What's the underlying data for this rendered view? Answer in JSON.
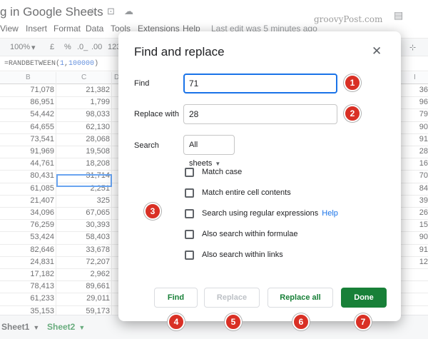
{
  "app": {
    "doc_title": "g in Google Sheets",
    "watermark": "groovyPost.com"
  },
  "menu": [
    "View",
    "Insert",
    "Format",
    "Data",
    "Tools",
    "Extensions",
    "Help"
  ],
  "last_edit": "Last edit was 5 minutes ago",
  "toolbar": {
    "zoom": "100%",
    "currency": "£",
    "percent": "%",
    "dec_decrease": ".0_",
    "dec_increase": ".00",
    "more_formats": "123"
  },
  "formula_bar": {
    "prefix": "=RANDBETWEEN(",
    "arg1": "1",
    "sep": ",",
    "arg2": "100000",
    "suffix": ")"
  },
  "grid": {
    "col_headers": [
      "B",
      "C",
      "D",
      "I"
    ],
    "col_b": [
      "71,078",
      "86,951",
      "54,442",
      "64,655",
      "73,541",
      "91,969",
      "44,761",
      "80,431",
      "61,085",
      "21,407",
      "34,096",
      "76,259",
      "53,424",
      "82,646",
      "24,831",
      "17,182",
      "78,413",
      "61,233",
      "35,153"
    ],
    "col_c": [
      "21,382",
      "1,799",
      "98,033",
      "62,130",
      "28,068",
      "19,508",
      "18,208",
      "31,714",
      "2,251",
      "325",
      "67,065",
      "30,393",
      "58,403",
      "33,678",
      "72,207",
      "2,962",
      "89,661",
      "29,011",
      "59,173"
    ],
    "col_i": [
      "36",
      "96",
      "79",
      "90",
      "91",
      "28",
      "16",
      "70",
      "84",
      "39",
      "26",
      "15",
      "90",
      "91",
      "12",
      "",
      "",
      "",
      ""
    ]
  },
  "sheets": [
    {
      "label": "Sheet1",
      "active": false
    },
    {
      "label": "Sheet2",
      "active": true
    }
  ],
  "dialog": {
    "title": "Find and replace",
    "close_icon": "close-icon",
    "find_label": "Find",
    "find_value": "71",
    "replace_label": "Replace with",
    "replace_value": "28",
    "search_label": "Search",
    "search_value": "All sheets",
    "options": [
      {
        "label": "Match case",
        "checked": false
      },
      {
        "label": "Match entire cell contents",
        "checked": false
      },
      {
        "label": "Search using regular expressions",
        "checked": false,
        "help": "Help"
      },
      {
        "label": "Also search within formulae",
        "checked": false
      },
      {
        "label": "Also search within links",
        "checked": false
      }
    ],
    "buttons": {
      "find": "Find",
      "replace": "Replace",
      "replace_all": "Replace all",
      "done": "Done"
    }
  },
  "callouts": [
    "1",
    "2",
    "3",
    "4",
    "5",
    "6",
    "7"
  ],
  "colors": {
    "accent_green": "#188038",
    "focus_blue": "#1a73e8",
    "callout_red": "#d93025"
  }
}
